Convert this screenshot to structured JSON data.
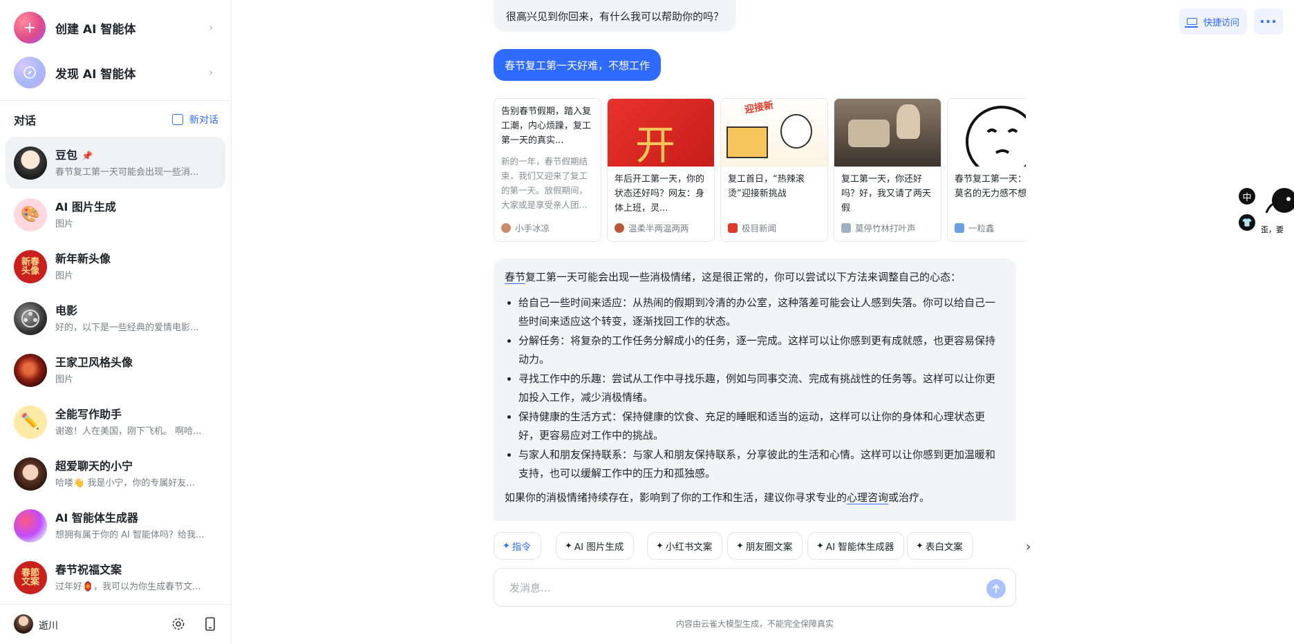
{
  "sidebar": {
    "create_label": "创建 AI 智能体",
    "discover_label": "发现 AI 智能体",
    "conversations_title": "对话",
    "new_conversation_label": "新对话",
    "items": [
      {
        "name": "豆包",
        "sub": "春节复工第一天可能会出现一些消...",
        "avatar_text": ""
      },
      {
        "name": "AI 图片生成",
        "sub": "图片",
        "avatar_text": ""
      },
      {
        "name": "新年新头像",
        "sub": "图片",
        "avatar_text": "新春头像"
      },
      {
        "name": "电影",
        "sub": "好的，以下是一些经典的爱情电影...",
        "avatar_text": ""
      },
      {
        "name": "王家卫风格头像",
        "sub": "图片",
        "avatar_text": ""
      },
      {
        "name": "全能写作助手",
        "sub": "谢邀！人在美国，刚下飞机。 啊哈...",
        "avatar_text": ""
      },
      {
        "name": "超爱聊天的小宁",
        "sub": "哈喽👋 我是小宁，你的专属好友...",
        "avatar_text": ""
      },
      {
        "name": "AI 智能体生成器",
        "sub": "想拥有属于你的 AI 智能体吗？给我...",
        "avatar_text": ""
      },
      {
        "name": "春节祝福文案",
        "sub": "过年好🏮，我可以为你生成春节文...",
        "avatar_text": "春節文案"
      }
    ],
    "user_name": "逝川"
  },
  "header": {
    "quick_access_label": "快捷访问",
    "more_label": "···"
  },
  "chat": {
    "ai_greeting": "很高兴见到你回来，有什么我可以帮助你的吗？",
    "user_message": "春节复工第一天好难，不想工作",
    "cards": [
      {
        "title": "告别春节假期，踏入复工潮，内心烦躁，复工第一天的真实...",
        "desc": "新的一年，春节假期结束，我们又迎来了复工的第一天。放假期间，大家或是享受亲人团...",
        "source": "小手冰凉",
        "img_caption": ""
      },
      {
        "title": "年后开工第一天，你的状态还好吗？网友：身体上班，灵...",
        "desc": "",
        "source": "温柔半两温两两",
        "img_caption": "开"
      },
      {
        "title": "复工首日，“热辣滚烫”迎接新挑战",
        "desc": "",
        "source": "极目新闻",
        "img_caption": "迎接新"
      },
      {
        "title": "复工第一天，你还好吗？好，我又请了两天假",
        "desc": "",
        "source": "莫停竹林打叶声",
        "img_caption": ""
      },
      {
        "title": "春节复工第一天：一种莫名的无力感不想上班!",
        "desc": "",
        "source": "一粒鑫",
        "img_caption": ""
      }
    ],
    "answer": {
      "intro_link": "春节",
      "intro_rest": "复工第一天可能会出现一些消极情绪，这是很正常的，你可以尝试以下方法来调整自己的心态：",
      "points": [
        "给自己一些时间来适应：从热闹的假期到冷清的办公室，这种落差可能会让人感到失落。你可以给自己一些时间来适应这个转变，逐渐找回工作的状态。",
        "分解任务：将复杂的工作任务分解成小的任务，逐一完成。这样可以让你感到更有成就感，也更容易保持动力。",
        "寻找工作中的乐趣：尝试从工作中寻找乐趣，例如与同事交流、完成有挑战性的任务等。这样可以让你更加投入工作，减少消极情绪。",
        "保持健康的生活方式：保持健康的饮食、充足的睡眠和适当的运动，这样可以让你的身体和心理状态更好，更容易应对工作中的挑战。",
        "与家人和朋友保持联系：与家人和朋友保持联系，分享彼此的生活和心情。这样可以让你感到更加温暖和支持，也可以缓解工作中的压力和孤独感。"
      ],
      "outro_before": "如果你的消极情绪持续存在，影响到了你的工作和生活，建议你寻求专业的",
      "outro_link": "心理咨询",
      "outro_after": "或治疗。"
    },
    "chips": [
      "指令",
      "AI 图片生成",
      "小红书文案",
      "朋友圈文案",
      "AI 智能体生成器",
      "表白文案"
    ],
    "input_placeholder": "发消息...",
    "disclaimer": "内容由云雀大模型生成，不能完全保障真实"
  },
  "floater": {
    "lang_badge": "中",
    "cartoon_caption": "歪，要"
  },
  "colors": {
    "accent": "#2f6bff",
    "bubble_bg": "#f3f4f6"
  }
}
